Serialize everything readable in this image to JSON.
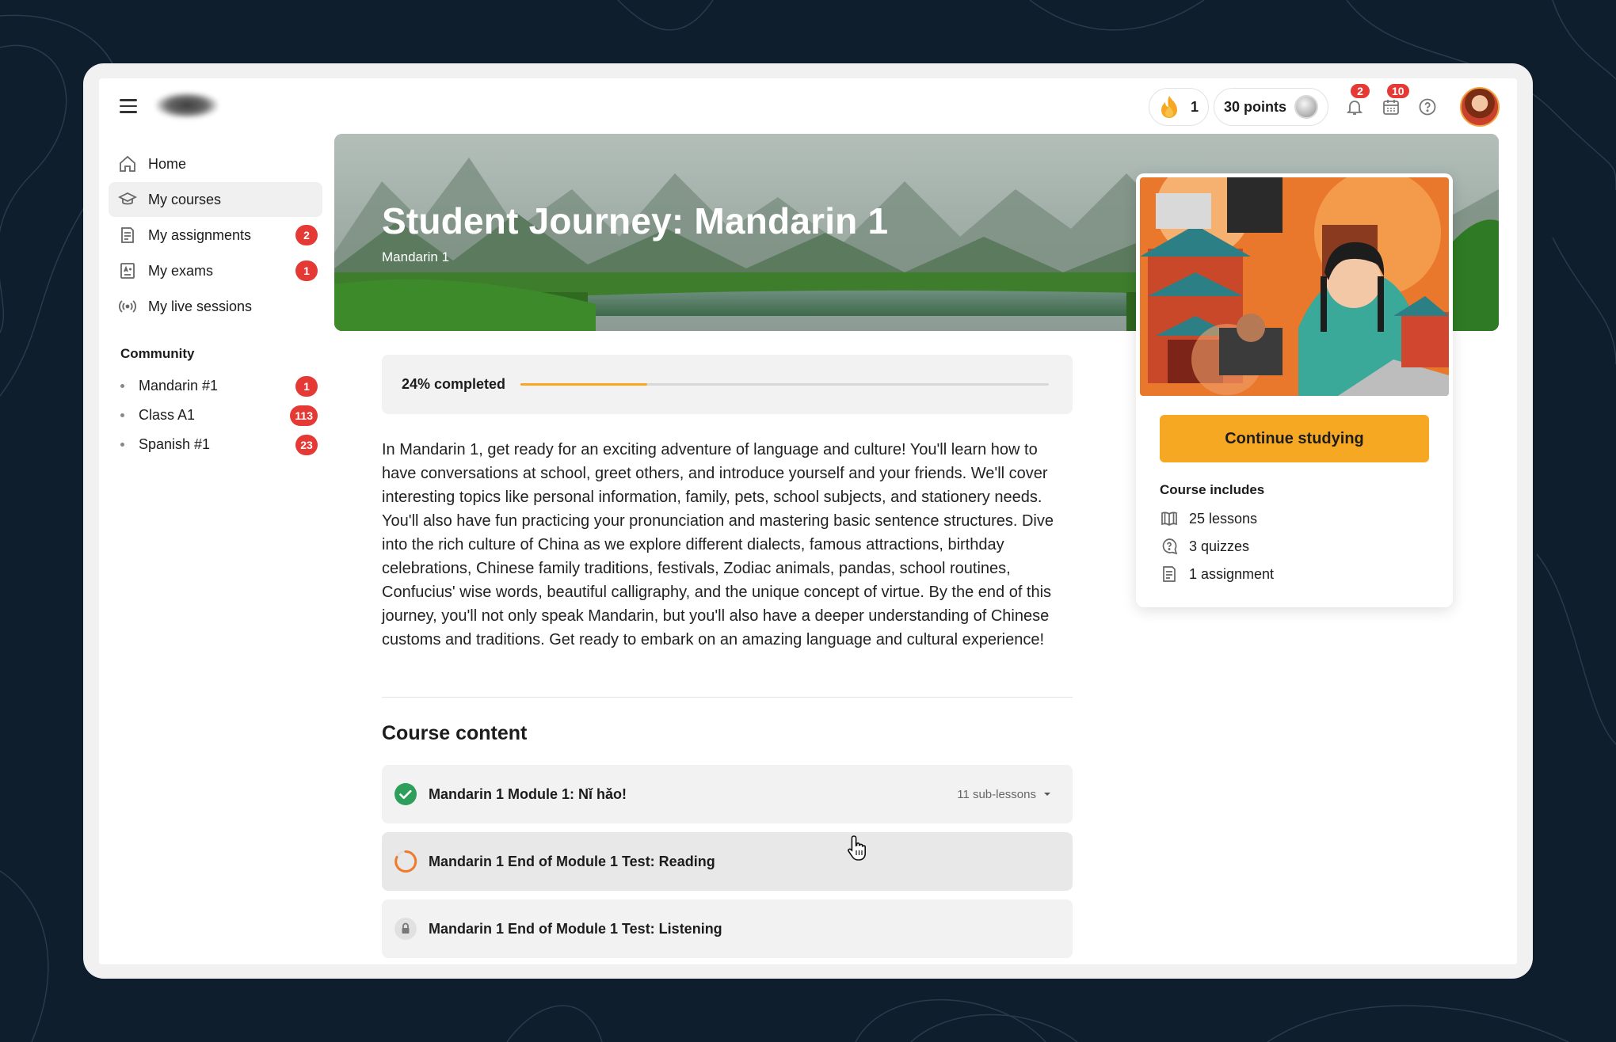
{
  "topbar": {
    "streak_count": "1",
    "points_label": "30 points",
    "notifications_badge": "2",
    "calendar_badge": "10"
  },
  "sidebar": {
    "items": [
      {
        "label": "Home",
        "icon": "home-icon"
      },
      {
        "label": "My courses",
        "icon": "graduation-cap-icon"
      },
      {
        "label": "My assignments",
        "icon": "assignment-icon",
        "badge": "2"
      },
      {
        "label": "My exams",
        "icon": "exam-icon",
        "badge": "1"
      },
      {
        "label": "My live sessions",
        "icon": "broadcast-icon"
      }
    ],
    "community_title": "Community",
    "community": [
      {
        "label": "Mandarin #1",
        "badge": "1"
      },
      {
        "label": "Class A1",
        "badge": "113"
      },
      {
        "label": "Spanish #1",
        "badge": "23"
      }
    ]
  },
  "hero": {
    "title": "Student Journey: Mandarin 1",
    "subtitle": "Mandarin 1"
  },
  "progress": {
    "label": "24% completed",
    "fraction": 0.24
  },
  "description": "In Mandarin 1, get ready for an exciting adventure of language and culture! You'll learn how to have conversations at school, greet others, and introduce yourself and your friends. We'll cover interesting topics like personal information, family, pets, school subjects, and stationery needs. You'll also have fun practicing your pronunciation and mastering basic sentence structures. Dive into the rich culture of China as we explore different dialects, famous attractions, birthday celebrations, Chinese family traditions, festivals, Zodiac animals, pandas, school routines, Confucius' wise words, beautiful calligraphy, and the unique concept of virtue. By the end of this journey, you'll not only speak Mandarin, but you'll also have a deeper understanding of Chinese customs and traditions. Get ready to embark on an amazing language and cultural experience!",
  "course_content": {
    "title": "Course content",
    "lessons": [
      {
        "title": "Mandarin 1 Module 1: Nǐ hǎo!",
        "status": "completed",
        "meta": "11 sub-lessons"
      },
      {
        "title": "Mandarin 1 End of Module 1 Test: Reading",
        "status": "in-progress"
      },
      {
        "title": "Mandarin 1 End of Module 1 Test: Listening",
        "status": "locked"
      }
    ]
  },
  "card": {
    "button_label": "Continue studying",
    "includes_title": "Course includes",
    "includes": [
      {
        "label": "25 lessons",
        "icon": "book-icon"
      },
      {
        "label": "3 quizzes",
        "icon": "quiz-icon"
      },
      {
        "label": "1 assignment",
        "icon": "assignment-icon"
      }
    ]
  },
  "colors": {
    "accent": "#f7a823",
    "badge": "#e53935",
    "success": "#2e9e5b",
    "background": "#0f1e2d"
  }
}
